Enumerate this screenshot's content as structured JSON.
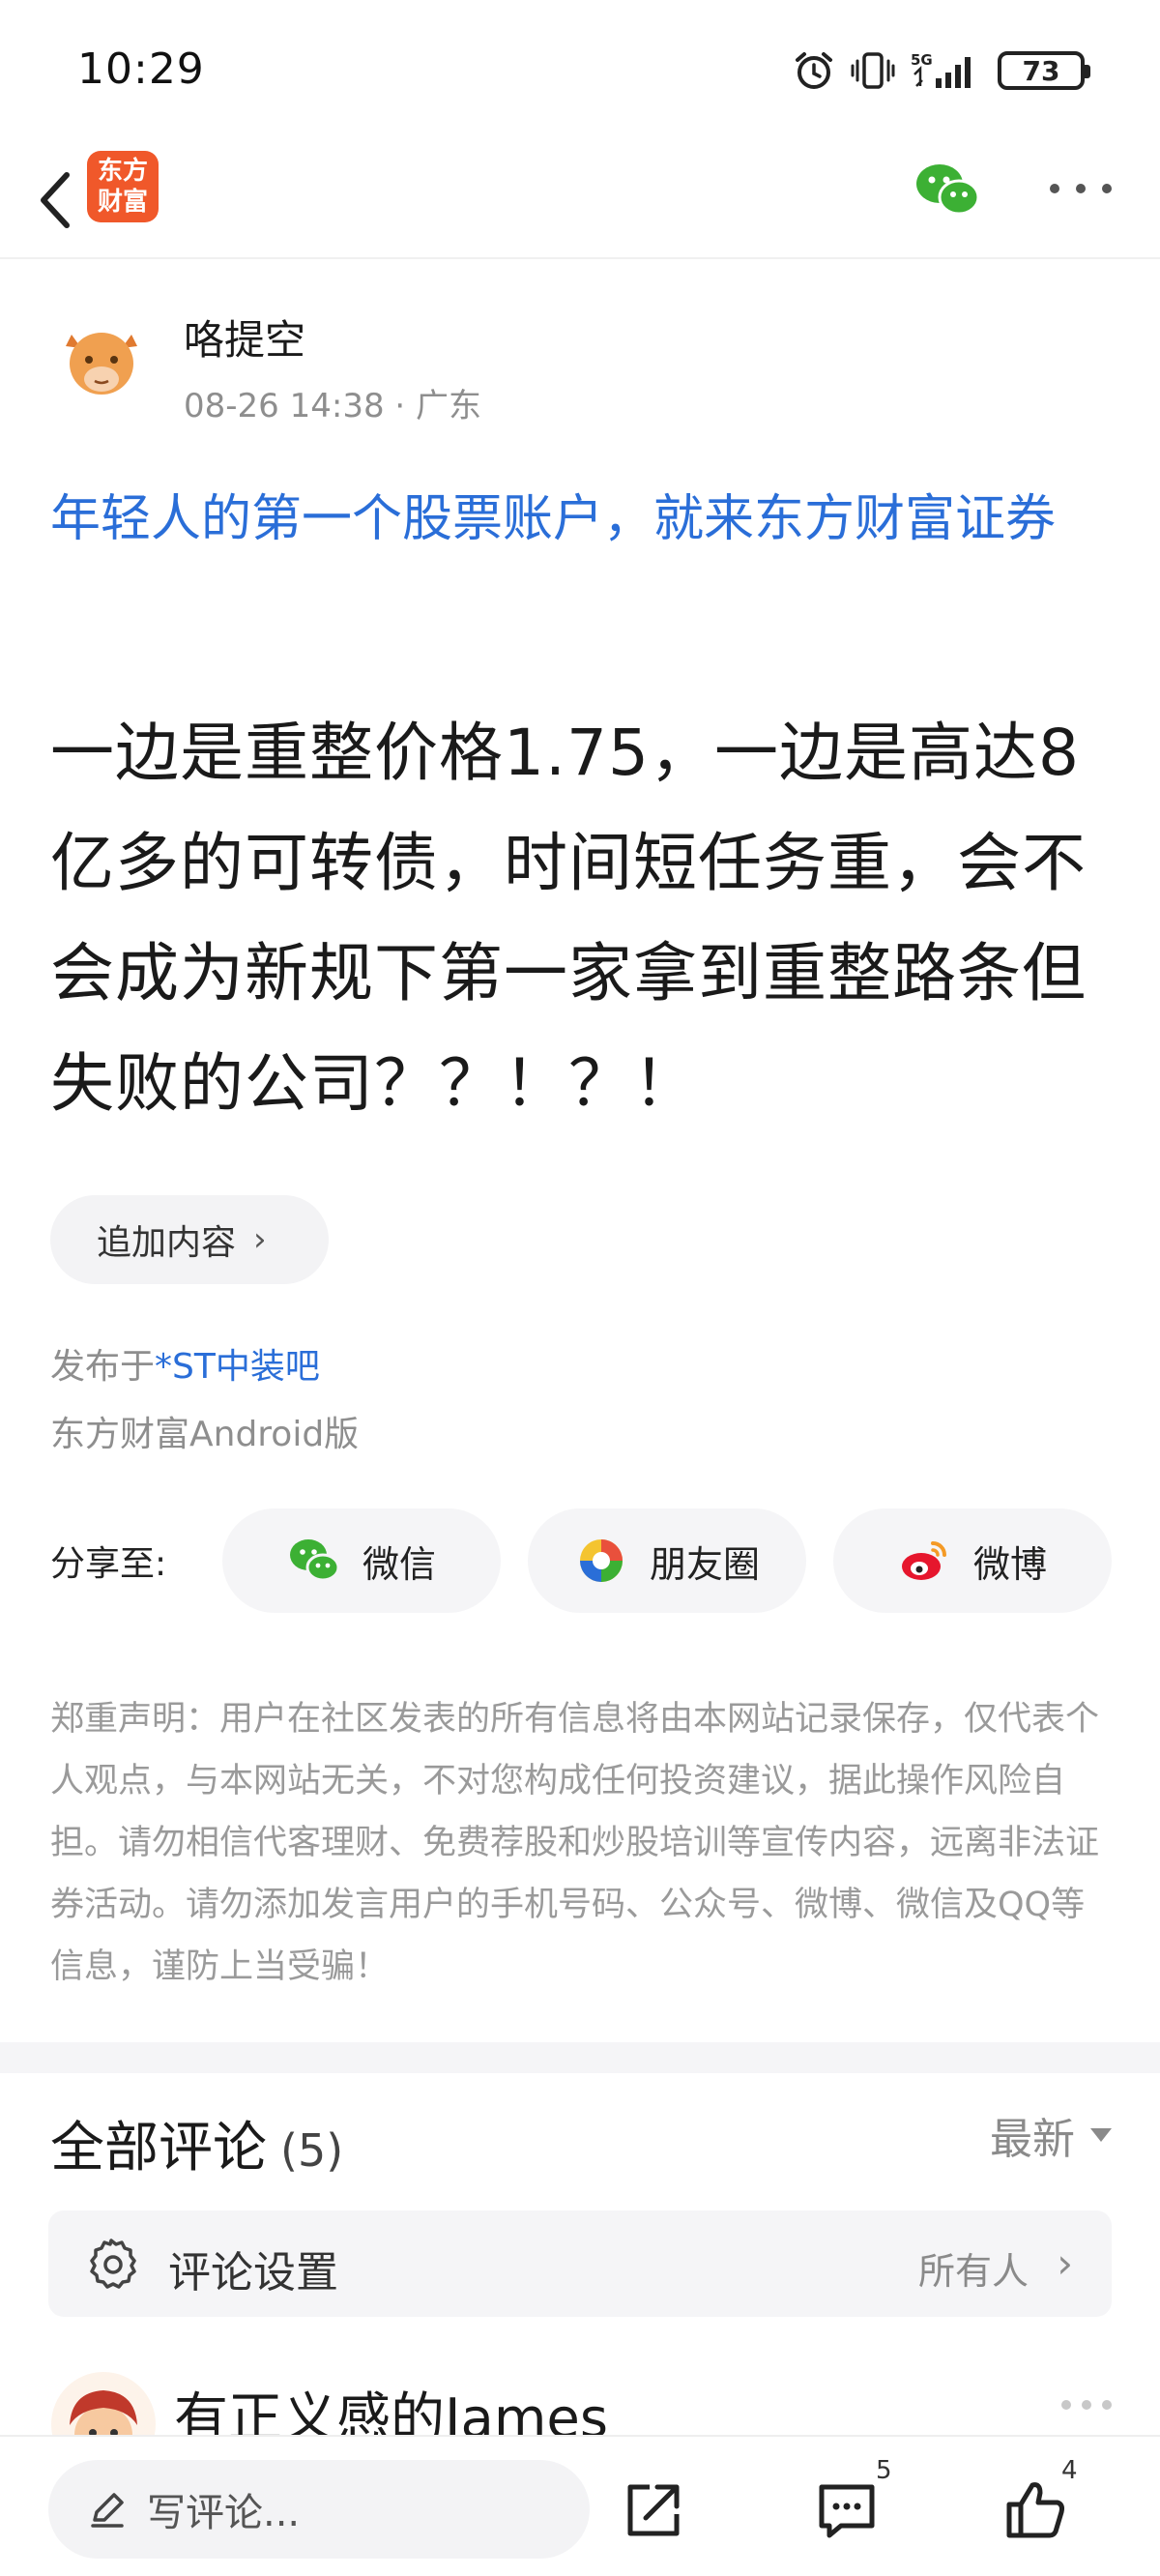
{
  "status_bar": {
    "time": "10:29",
    "battery": "73",
    "network": "5G"
  },
  "nav": {
    "logo_line1": "东方",
    "logo_line2": "财富"
  },
  "author": {
    "name": "咯提空",
    "meta": "08-26 14:38 · 广东"
  },
  "promo_link": "年轻人的第一个股票账户，就来东方财富证券",
  "post_title": "一边是重整价格1.75，一边是高达8亿多的可转债，时间短任务重，会不会成为新规下第一家拿到重整路条但失败的公司？？！？！",
  "add_content_label": "追加内容",
  "posted_in": {
    "prefix": "发布于",
    "bar_name": "*ST中装吧"
  },
  "platform": "东方财富Android版",
  "share": {
    "label": "分享至:",
    "items": [
      {
        "label": "微信",
        "icon": "wechat-icon"
      },
      {
        "label": "朋友圈",
        "icon": "moments-icon"
      },
      {
        "label": "微博",
        "icon": "weibo-icon"
      }
    ]
  },
  "disclaimer": "郑重声明：用户在社区发表的所有信息将由本网站记录保存，仅代表个人观点，与本网站无关，不对您构成任何投资建议，据此操作风险自担。请勿相信代客理财、免费荐股和炒股培训等宣传内容，远离非法证券活动。请勿添加发言用户的手机号码、公众号、微博、微信及QQ等信息，谨防上当受骗！",
  "comments": {
    "title": "全部评论",
    "count": "(5)",
    "sort_label": "最新",
    "settings_label": "评论设置",
    "settings_value": "所有人",
    "first_commenter": "有正义感的James"
  },
  "bottom_bar": {
    "input_placeholder": "写评论...",
    "comment_count": "5",
    "like_count": "4"
  },
  "colors": {
    "accent_blue": "#2a6ed8",
    "brand_orange": "#f0582a",
    "wechat_green": "#3cb034"
  }
}
